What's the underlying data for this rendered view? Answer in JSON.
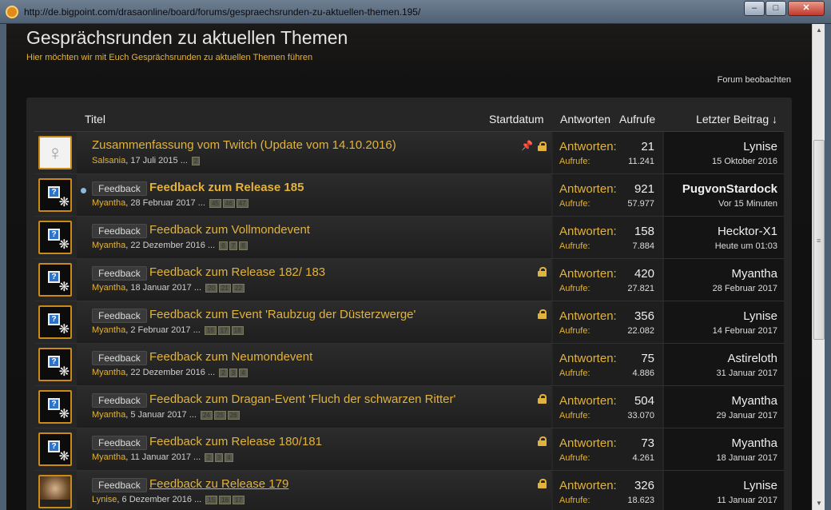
{
  "browser": {
    "url": "http://de.bigpoint.com/drasaonline/board/forums/gespraechsrunden-zu-aktuellen-themen.195/"
  },
  "page": {
    "title": "Gesprächsrunden zu aktuellen Themen",
    "subtitle": "Hier möchten wir mit Euch Gesprächsrunden zu aktuellen Themen führen",
    "watch_label": "Forum beobachten"
  },
  "columns": {
    "title": "Titel",
    "start": "Startdatum",
    "replies": "Antworten",
    "views": "Aufrufe",
    "last": "Letzter Beitrag ↓"
  },
  "labels": {
    "replies": "Antworten:",
    "views": "Aufrufe:"
  },
  "accent_color": "#e2b33c",
  "threads": [
    {
      "avatar": "venus-icon",
      "prefix": "",
      "title": "Zusammenfassung vom Twitch (Update vom 14.10.2016)",
      "author": "Salsania",
      "date": "17 Juli 2015",
      "dots": "...",
      "pages": [
        "2"
      ],
      "pinned": true,
      "locked": true,
      "unread": false,
      "replies": "21",
      "views": "11.241",
      "last_user": "Lynise",
      "last_date": "15 Oktober 2016"
    },
    {
      "avatar": "question-icon",
      "prefix": "Feedback",
      "title": "Feedback zum Release 185",
      "author": "Myantha",
      "date": "28 Februar 2017",
      "dots": "...",
      "pages": [
        "45",
        "46",
        "47"
      ],
      "pinned": false,
      "locked": false,
      "unread": true,
      "replies": "921",
      "views": "57.977",
      "last_user": "PugvonStardock",
      "last_date": "Vor 15 Minuten"
    },
    {
      "avatar": "question-icon",
      "prefix": "Feedback",
      "title": "Feedback zum Vollmondevent",
      "author": "Myantha",
      "date": "22 Dezember 2016",
      "dots": "...",
      "pages": [
        "6",
        "7",
        "8"
      ],
      "pinned": false,
      "locked": false,
      "unread": false,
      "replies": "158",
      "views": "7.884",
      "last_user": "Hecktor-X1",
      "last_date": "Heute um 01:03"
    },
    {
      "avatar": "question-icon",
      "prefix": "Feedback",
      "title": "Feedback zum Release 182/ 183",
      "author": "Myantha",
      "date": "18 Januar 2017",
      "dots": "...",
      "pages": [
        "20",
        "21",
        "22"
      ],
      "pinned": false,
      "locked": true,
      "unread": false,
      "replies": "420",
      "views": "27.821",
      "last_user": "Myantha",
      "last_date": "28 Februar 2017"
    },
    {
      "avatar": "question-icon",
      "prefix": "Feedback",
      "title": "Feedback zum Event 'Raubzug der Düsterzwerge'",
      "author": "Myantha",
      "date": "2 Februar 2017",
      "dots": "...",
      "pages": [
        "16",
        "17",
        "18"
      ],
      "pinned": false,
      "locked": true,
      "unread": false,
      "replies": "356",
      "views": "22.082",
      "last_user": "Lynise",
      "last_date": "14 Februar 2017"
    },
    {
      "avatar": "question-icon",
      "prefix": "Feedback",
      "title": "Feedback zum Neumondevent",
      "author": "Myantha",
      "date": "22 Dezember 2016",
      "dots": "...",
      "pages": [
        "2",
        "3",
        "4"
      ],
      "pinned": false,
      "locked": false,
      "unread": false,
      "replies": "75",
      "views": "4.886",
      "last_user": "Astireloth",
      "last_date": "31 Januar 2017"
    },
    {
      "avatar": "question-icon",
      "prefix": "Feedback",
      "title": "Feedback zum Dragan-Event 'Fluch der schwarzen Ritter'",
      "author": "Myantha",
      "date": "5 Januar 2017",
      "dots": "...",
      "pages": [
        "24",
        "25",
        "26"
      ],
      "pinned": false,
      "locked": true,
      "unread": false,
      "replies": "504",
      "views": "33.070",
      "last_user": "Myantha",
      "last_date": "29 Januar 2017"
    },
    {
      "avatar": "question-icon",
      "prefix": "Feedback",
      "title": "Feedback zum Release 180/181",
      "author": "Myantha",
      "date": "11 Januar 2017",
      "dots": "...",
      "pages": [
        "2",
        "3",
        "4"
      ],
      "pinned": false,
      "locked": true,
      "unread": false,
      "replies": "73",
      "views": "4.261",
      "last_user": "Myantha",
      "last_date": "18 Januar 2017"
    },
    {
      "avatar": "photo",
      "prefix": "Feedback",
      "title": "Feedback zu Release 179",
      "author": "Lynise",
      "date": "6 Dezember 2016",
      "dots": "...",
      "pages": [
        "15",
        "16",
        "17"
      ],
      "pinned": false,
      "locked": true,
      "unread": false,
      "replies": "326",
      "views": "18.623",
      "last_user": "Lynise",
      "last_date": "11 Januar 2017"
    }
  ]
}
